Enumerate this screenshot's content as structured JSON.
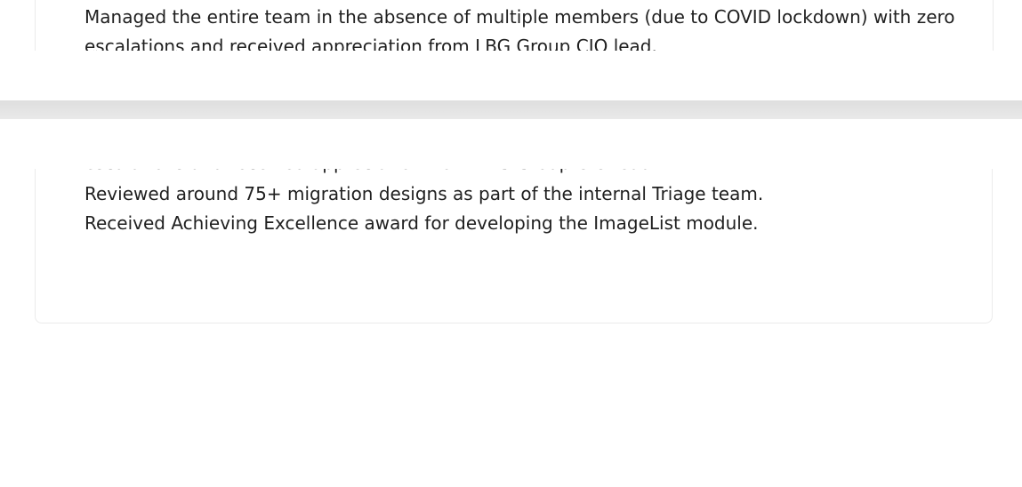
{
  "achievements": [
    "Managed the entire team in the absence of multiple members (due to COVID lockdown) with zero",
    "escalations and received appreciation from LBG Group CIO lead.",
    "Reviewed around 75+ migration designs as part of the internal Triage team.",
    "Received Achieving Excellence award for developing the ImageList module."
  ]
}
